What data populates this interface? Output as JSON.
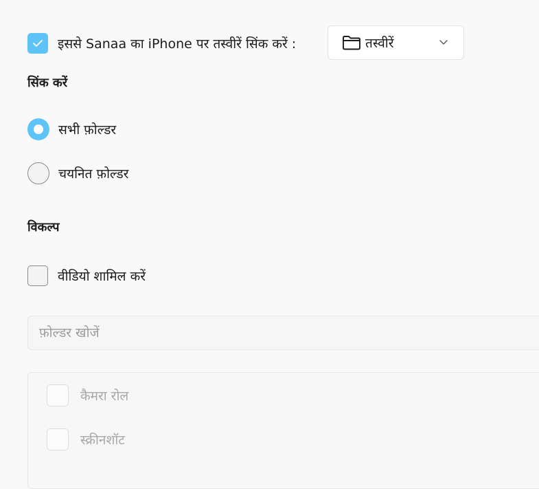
{
  "sync": {
    "checked": true,
    "label": "इससे Sanaa का iPhone पर तस्वीरें सिंक करें :",
    "dropdown": {
      "selected": "तस्वीरें",
      "icon": "folder-icon"
    }
  },
  "sync_section": {
    "heading": "सिंक करें",
    "options": [
      {
        "label": "सभी फ़ोल्डर",
        "selected": true
      },
      {
        "label": "चयनित फ़ोल्डर",
        "selected": false
      }
    ]
  },
  "options_section": {
    "heading": "विकल्प",
    "include_video": {
      "label": "वीडियो शामिल करें",
      "checked": false
    }
  },
  "folder_search": {
    "placeholder": "फ़ोल्डर खोजें"
  },
  "folders": [
    {
      "label": "कैमरा रोल",
      "checked": false,
      "disabled": true
    },
    {
      "label": "स्क्रीनशॉट",
      "checked": false,
      "disabled": true
    }
  ],
  "colors": {
    "accent": "#5ec3f7",
    "background": "#f9f9f9",
    "disabled_text": "#a8a8a8"
  }
}
